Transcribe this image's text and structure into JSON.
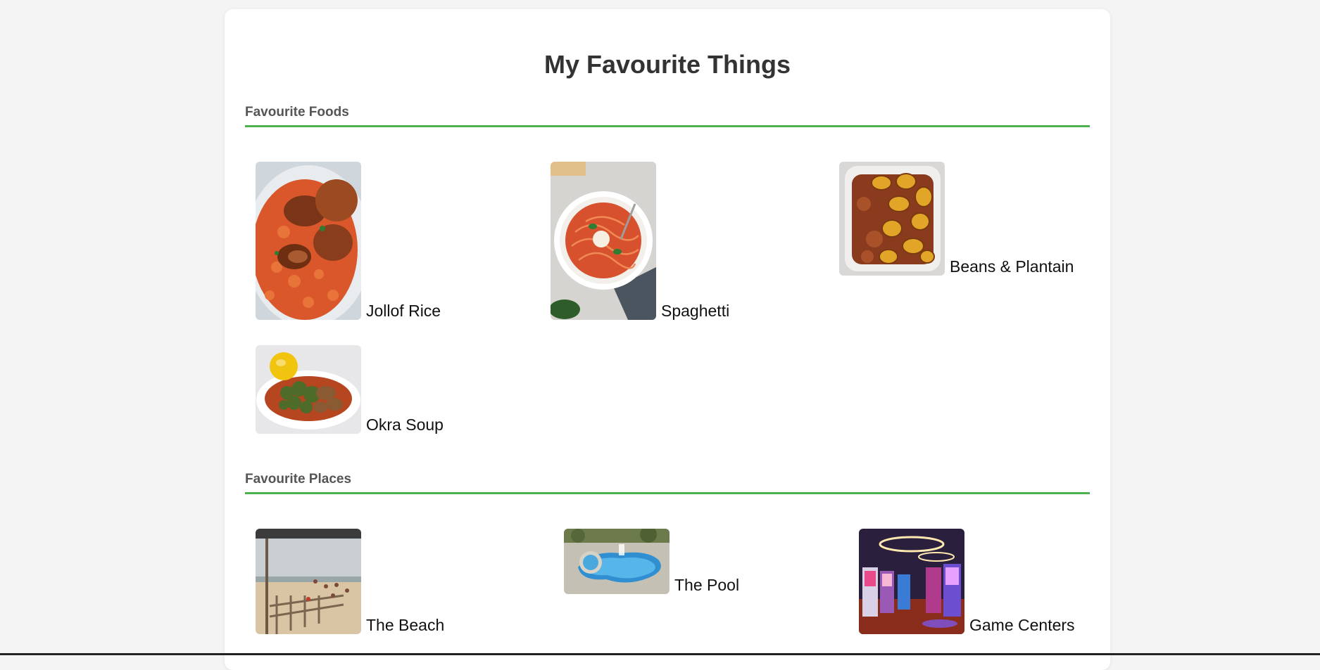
{
  "page": {
    "title": "My Favourite Things",
    "accent_color": "#4caf50",
    "background_color": "#f4f4f4"
  },
  "sections": {
    "foods": {
      "heading": "Favourite Foods",
      "items": [
        {
          "label": "Jollof Rice",
          "image": "jollof-rice-photo"
        },
        {
          "label": "Spaghetti",
          "image": "spaghetti-photo"
        },
        {
          "label": "Beans & Plantain",
          "image": "beans-plantain-photo"
        },
        {
          "label": "Okra Soup",
          "image": "okra-soup-photo"
        }
      ]
    },
    "places": {
      "heading": "Favourite Places",
      "items": [
        {
          "label": "The Beach",
          "image": "beach-photo"
        },
        {
          "label": "The Pool",
          "image": "pool-photo"
        },
        {
          "label": "Game Centers",
          "image": "game-center-photo"
        }
      ]
    }
  }
}
